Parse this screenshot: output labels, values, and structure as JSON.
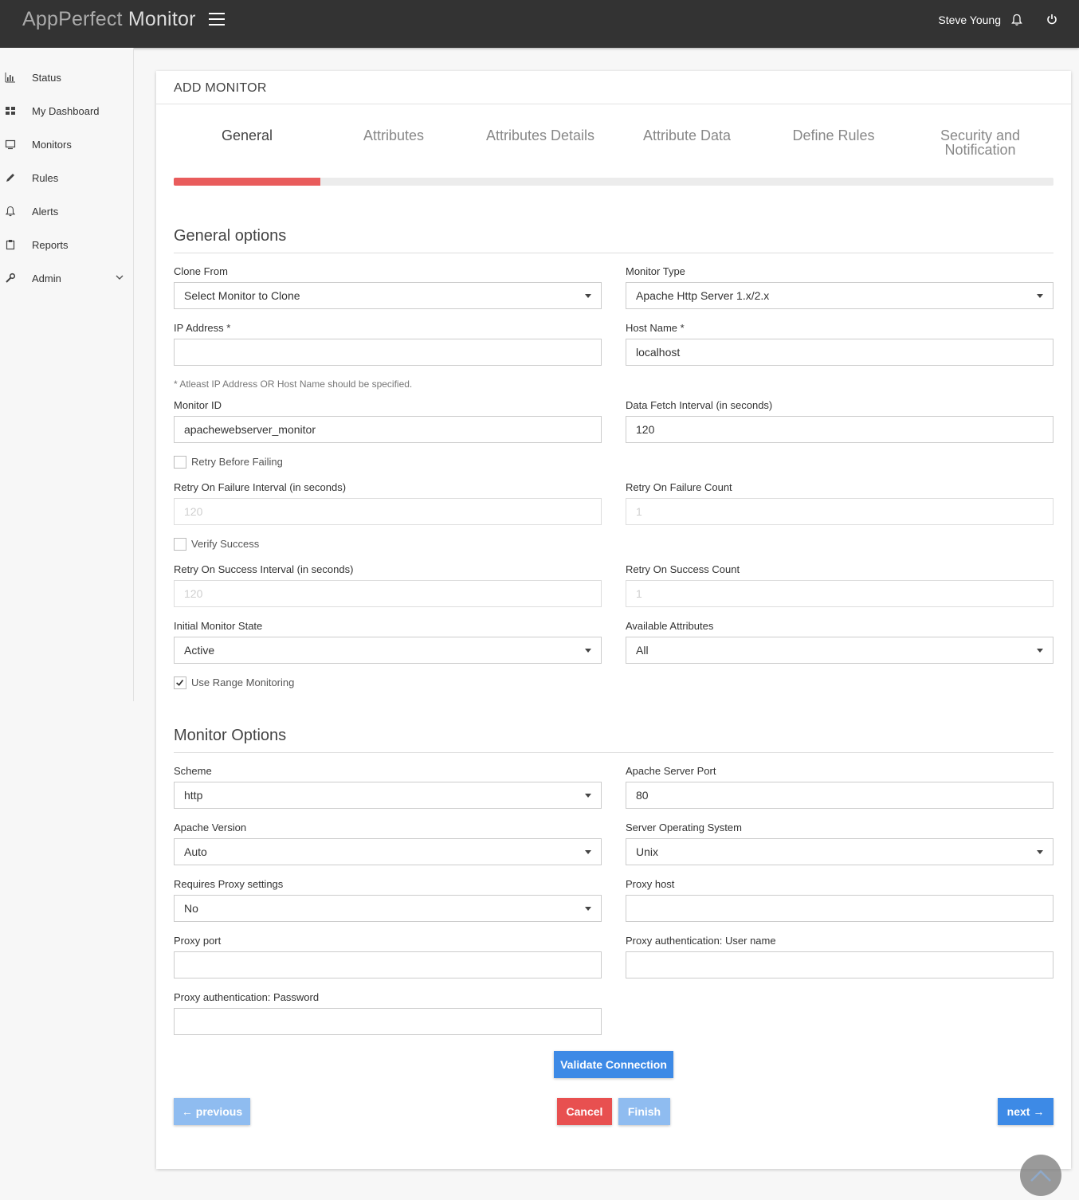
{
  "app": {
    "brand_light": "AppPerfect ",
    "brand_strong": "Monitor",
    "username": "Steve Young",
    "icons": {
      "menu": "hamburger-icon",
      "notifications": "bell-icon",
      "logout": "power-icon"
    }
  },
  "sidebar": {
    "items": [
      {
        "label": "Status",
        "icon": "bar-chart-icon"
      },
      {
        "label": "My Dashboard",
        "icon": "grid-icon"
      },
      {
        "label": "Monitors",
        "icon": "monitor-icon"
      },
      {
        "label": "Rules",
        "icon": "pencil-icon"
      },
      {
        "label": "Alerts",
        "icon": "bell-icon"
      },
      {
        "label": "Reports",
        "icon": "clipboard-icon"
      },
      {
        "label": "Admin",
        "icon": "wrench-icon",
        "has_submenu": true
      }
    ]
  },
  "page": {
    "title": "ADD MONITOR",
    "tabs": [
      {
        "label": "General",
        "active": true
      },
      {
        "label": "Attributes"
      },
      {
        "label": "Attributes Details"
      },
      {
        "label": "Attribute Data"
      },
      {
        "label": "Define Rules"
      },
      {
        "label": "Security and Notification"
      }
    ],
    "progress_fraction": 0.1667,
    "progress_color": "#e95c5c"
  },
  "general": {
    "section_title": "General options",
    "clone_from": {
      "label": "Clone From",
      "value": "Select Monitor to Clone"
    },
    "monitor_type": {
      "label": "Monitor Type",
      "value": "Apache Http Server 1.x/2.x"
    },
    "ip_address": {
      "label": "IP Address *",
      "value": ""
    },
    "host_name": {
      "label": "Host Name *",
      "value": "localhost"
    },
    "ip_host_note": "* Atleast IP Address OR Host Name should be specified.",
    "monitor_id": {
      "label": "Monitor ID",
      "value": "apachewebserver_monitor"
    },
    "fetch_interval": {
      "label": "Data Fetch Interval (in seconds)",
      "value": "120"
    },
    "retry_before_failing": {
      "label": "Retry Before Failing",
      "checked": false
    },
    "retry_failure_interval": {
      "label": "Retry On Failure Interval (in seconds)",
      "value": "120"
    },
    "retry_failure_count": {
      "label": "Retry On Failure Count",
      "value": "1"
    },
    "verify_success": {
      "label": "Verify Success",
      "checked": false
    },
    "retry_success_interval": {
      "label": "Retry On Success Interval (in seconds)",
      "value": "120"
    },
    "retry_success_count": {
      "label": "Retry On Success Count",
      "value": "1"
    },
    "initial_state": {
      "label": "Initial Monitor State",
      "value": "Active"
    },
    "available_attributes": {
      "label": "Available Attributes",
      "value": "All"
    },
    "use_range_monitoring": {
      "label": "Use Range Monitoring",
      "checked": true
    }
  },
  "monitor_options": {
    "section_title": "Monitor Options",
    "scheme": {
      "label": "Scheme",
      "value": "http"
    },
    "server_port": {
      "label": "Apache Server Port",
      "value": "80"
    },
    "apache_version": {
      "label": "Apache Version",
      "value": "Auto"
    },
    "server_os": {
      "label": "Server Operating System",
      "value": "Unix"
    },
    "requires_proxy": {
      "label": "Requires Proxy settings",
      "value": "No"
    },
    "proxy_host": {
      "label": "Proxy host",
      "value": ""
    },
    "proxy_port": {
      "label": "Proxy port",
      "value": ""
    },
    "proxy_user": {
      "label": "Proxy authentication: User name",
      "value": ""
    },
    "proxy_password": {
      "label": "Proxy authentication: Password",
      "value": ""
    }
  },
  "buttons": {
    "validate": "Validate Connection",
    "previous": "← previous",
    "cancel": "Cancel",
    "finish": "Finish",
    "next": "next →",
    "colors": {
      "primary": "#3d8ae6",
      "primary_disabled": "#8fbcf0",
      "danger": "#e85050"
    }
  }
}
